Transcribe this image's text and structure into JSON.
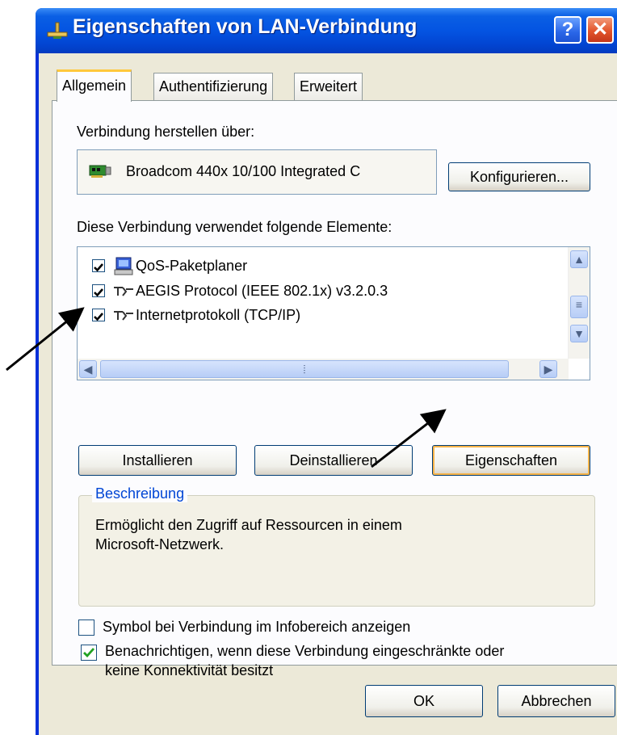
{
  "window": {
    "title": "Eigenschaften von LAN-Verbindung",
    "help_glyph": "?",
    "close_glyph": "✕"
  },
  "tabs": [
    {
      "label": "Allgemein",
      "active": true
    },
    {
      "label": "Authentifizierung",
      "active": false
    },
    {
      "label": "Erweitert",
      "active": false
    }
  ],
  "general": {
    "connect_using_label": "Verbindung herstellen über:",
    "adapter_name": "Broadcom 440x 10/100 Integrated C",
    "configure_button": "Konfigurieren...",
    "components_label": "Diese Verbindung verwendet folgende Elemente:",
    "components": [
      {
        "label": "QoS-Paketplaner",
        "checked": true,
        "icon": "qos-scheduler-icon"
      },
      {
        "label": "AEGIS Protocol (IEEE 802.1x) v3.2.0.3",
        "checked": true,
        "icon": "network-protocol-icon"
      },
      {
        "label": "Internetprotokoll (TCP/IP)",
        "checked": true,
        "icon": "network-protocol-icon"
      }
    ],
    "install_button": "Installieren",
    "uninstall_button": "Deinstallieren",
    "properties_button": "Eigenschaften",
    "description_title": "Beschreibung",
    "description_line1": "Ermöglicht den Zugriff auf Ressourcen in einem",
    "description_line2": "Microsoft-Netzwerk.",
    "show_icon_label": "Symbol bei Verbindung im Infobereich anzeigen",
    "show_icon_checked": false,
    "notify_line1": "Benachrichtigen, wenn diese Verbindung eingeschränkte oder",
    "notify_line2": "keine Konnektivität besitzt",
    "notify_checked": true
  },
  "footer": {
    "ok_button": "OK",
    "cancel_button": "Abbrechen"
  },
  "colors": {
    "titlebar": "#0454e2",
    "dialog_bg": "#ece9d8",
    "focus": "#f8b449",
    "checkmark": "#21a121"
  }
}
